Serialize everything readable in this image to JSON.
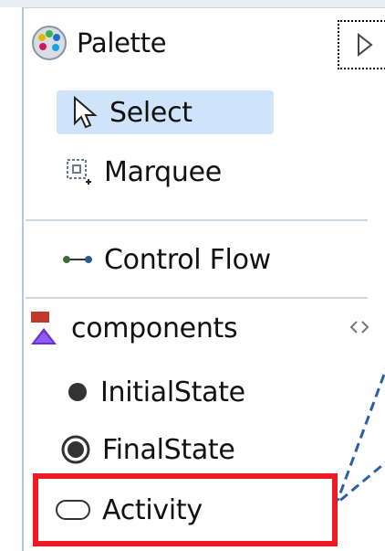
{
  "palette": {
    "title": "Palette",
    "icon": "palette-icon",
    "collapse_icon": "collapse-triangle-icon"
  },
  "tools": [
    {
      "label": "Select",
      "icon": "arrow-cursor-icon",
      "selected": true
    },
    {
      "label": "Marquee",
      "icon": "marquee-icon",
      "selected": false
    }
  ],
  "connections": [
    {
      "label": "Control Flow",
      "icon": "connection-icon"
    }
  ],
  "drawer": {
    "title": "components",
    "icon": "shapes-icon",
    "toggle_icon": "drawer-toggle-icon",
    "items": [
      {
        "label": "InitialState",
        "icon": "filled-circle-icon"
      },
      {
        "label": "FinalState",
        "icon": "final-state-icon"
      },
      {
        "label": "Activity",
        "icon": "rounded-rectangle-icon"
      }
    ]
  },
  "colors": {
    "selection": "#cfe3fb",
    "highlight": "#ee1b24",
    "dashed_line": "#2a5fa7"
  }
}
